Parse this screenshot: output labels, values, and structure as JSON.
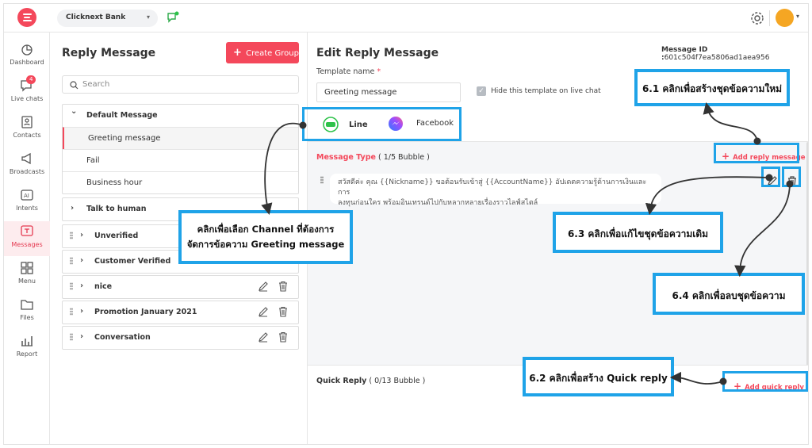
{
  "topbar": {
    "workspace": "Clicknext Bank",
    "workspace_caret": "▾",
    "avatar_caret": "▾"
  },
  "sidebar": {
    "items": [
      {
        "label": "Dashboard",
        "icon": "dashboard-icon"
      },
      {
        "label": "Live chats",
        "icon": "chat-icon",
        "badge": "4"
      },
      {
        "label": "Contacts",
        "icon": "contacts-icon"
      },
      {
        "label": "Broadcasts",
        "icon": "megaphone-icon"
      },
      {
        "label": "Intents",
        "icon": "ai-icon"
      },
      {
        "label": "Messages",
        "icon": "messages-icon",
        "active": true
      },
      {
        "label": "Menu",
        "icon": "grid-icon"
      },
      {
        "label": "Files",
        "icon": "folder-icon"
      },
      {
        "label": "Report",
        "icon": "chart-icon"
      }
    ]
  },
  "list": {
    "title": "Reply Message",
    "create_button": "Create Group",
    "create_plus": "+",
    "search_placeholder": "Search",
    "groups": [
      {
        "name": "Default Message",
        "expanded": true,
        "children": [
          "Greeting message",
          "Fail",
          "Business hour"
        ]
      },
      {
        "name": "Talk to human"
      },
      {
        "name": "Unverified"
      },
      {
        "name": "Customer Verified"
      },
      {
        "name": "nice"
      },
      {
        "name": "Promotion January 2021"
      },
      {
        "name": "Conversation"
      }
    ],
    "chevron_down": "⌄",
    "chevron_right": "›"
  },
  "edit": {
    "title": "Edit Reply Message",
    "message_id_label": "Message ID :",
    "message_id": "601c504f7ea5806ad1aea956",
    "template_name_label": "Template name",
    "required_mark": "*",
    "template_name_value": "Greeting message",
    "hide_label": "Hide this template on live chat",
    "checkmark": "✓",
    "tabs": [
      {
        "label": "Line",
        "active": true,
        "icon": "line-icon"
      },
      {
        "label": "Facebook",
        "icon": "messenger-icon"
      }
    ],
    "message_type_label": "Message Type",
    "message_type_count": "( 1/5 Bubble )",
    "add_reply_label": "Add reply message",
    "add_plus": "+",
    "bubble_text_line1": "สวัสดีค่ะ คุณ {{Nickname}} ขอต้อนรับเข้าสู่ {{AccountName}} อัปเดตความรู้ด้านการเงินและการ",
    "bubble_text_line2": "ลงทุนก่อนใคร พร้อมอินเทรนด์ไปกับหลากหลายเรื่องราวไลฟ์สไตล์",
    "quick_reply_label": "Quick Reply",
    "quick_reply_count": "( 0/13 Bubble )",
    "add_quick_label": "Add quick reply"
  },
  "callouts": {
    "c61": "6.1 คลิกเพื่อสร้างชุดข้อความใหม่",
    "c62": "6.2 คลิกเพื่อสร้าง Quick reply",
    "c63": "6.3 คลิกเพื่อแก้ไขชุดข้อความเดิม",
    "c64": "6.4 คลิกเพื่อลบชุดข้อความ",
    "channel_line1": "คลิกเพื่อเลือก Channel ที่ต้องการ",
    "channel_line2": "จัดการข้อความ Greeting message"
  },
  "colors": {
    "accent": "#f4485b",
    "callout_border": "#1fa3e8",
    "line_green": "#2ec24a",
    "messenger": "#7b5cff"
  }
}
